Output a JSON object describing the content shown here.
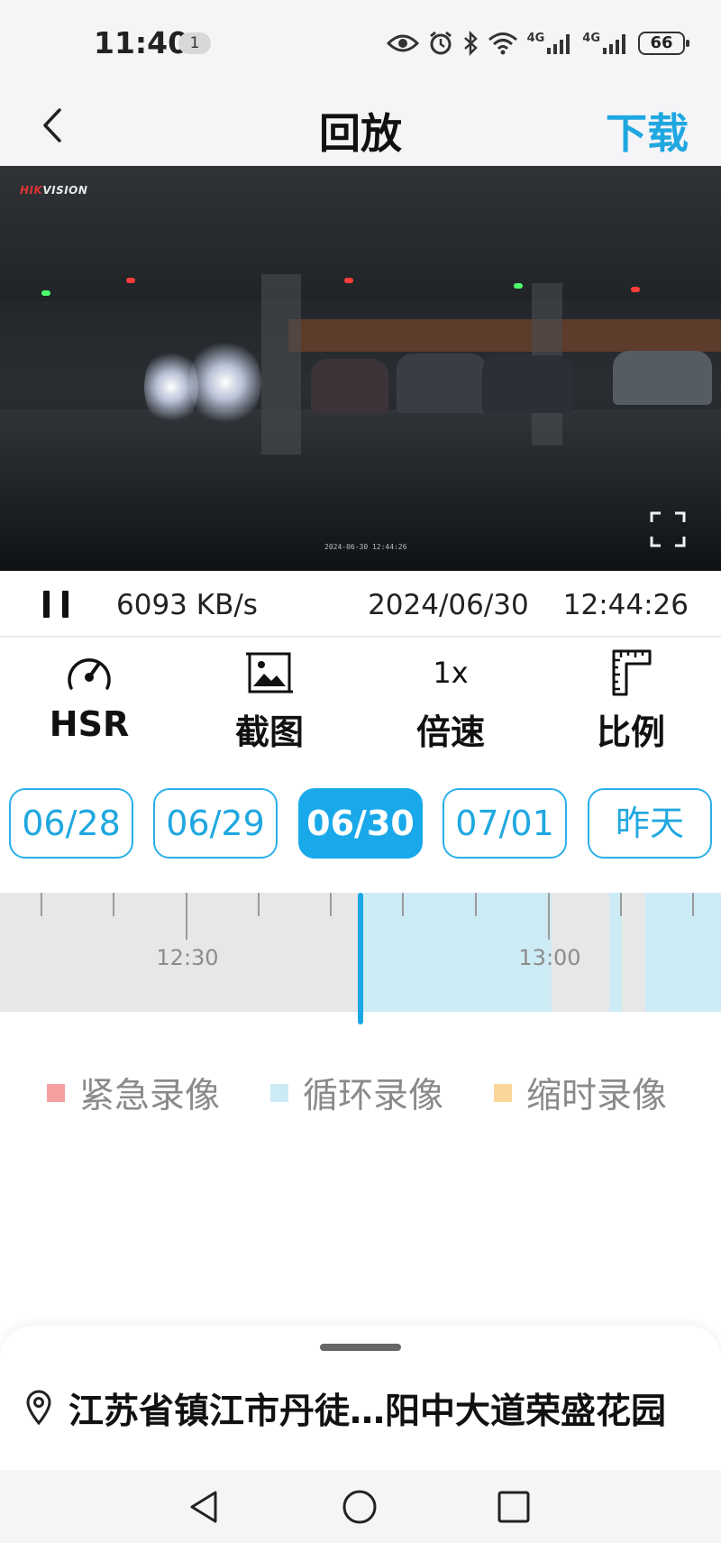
{
  "status_bar": {
    "time": "11:40",
    "notification_count": "1",
    "network_1": "4G",
    "network_2": "4G",
    "battery": "66",
    "icons": [
      "eye-icon",
      "alarm-icon",
      "bluetooth-icon",
      "wifi-icon",
      "signal-icon",
      "signal-icon",
      "battery-icon"
    ]
  },
  "header": {
    "title": "回放",
    "download_label": "下载"
  },
  "video": {
    "brand": "HIKVISION",
    "timestamp_overlay": "2024-06-30 12:44:26"
  },
  "info_bar": {
    "bitrate": "6093 KB/s",
    "date": "2024/06/30",
    "time": "12:44:26"
  },
  "toolbar": {
    "hsr_label": "HSR",
    "screenshot_label": "截图",
    "speed_value": "1x",
    "speed_label": "倍速",
    "ratio_label": "比例"
  },
  "dates": {
    "items": [
      "06/28",
      "06/29",
      "06/30",
      "07/01",
      "昨天"
    ],
    "selected": "06/30"
  },
  "timeline": {
    "tick_labels": [
      "12:30",
      "13:00"
    ]
  },
  "legend": {
    "emergency": "紧急录像",
    "loop": "循环录像",
    "timelapse": "缩时录像",
    "colors": {
      "emergency": "#f5a0a0",
      "loop": "#cdebf5",
      "timelapse": "#fbd69a"
    }
  },
  "location": {
    "address": "江苏省镇江市丹徒…阳中大道荣盛花园"
  },
  "colors": {
    "accent": "#1fa7e0",
    "selected_chip": "#19a9ea"
  }
}
